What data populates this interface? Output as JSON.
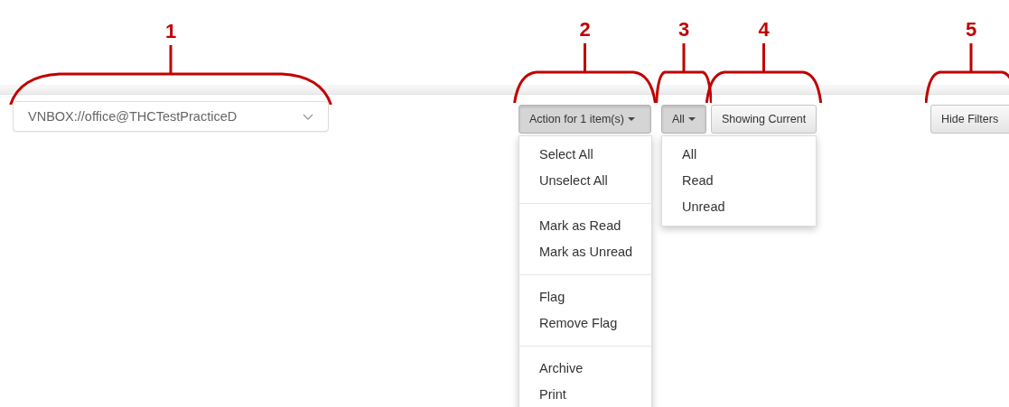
{
  "account_select": {
    "value": "VNBOX://office@THCTestPracticeD",
    "callout": "1"
  },
  "toolbar": [
    {
      "kind": "dropdown",
      "label": "Action for 1 item(s)",
      "callout": "2",
      "expanded": true,
      "menu": [
        [
          "Select All",
          "Unselect All"
        ],
        [
          "Mark as Read",
          "Mark as Unread"
        ],
        [
          "Flag",
          "Remove Flag"
        ],
        [
          "Archive",
          "Print"
        ]
      ]
    },
    {
      "kind": "dropdown",
      "label": "All",
      "callout": "3",
      "expanded": true,
      "menu": [
        [
          "All",
          "Read",
          "Unread"
        ]
      ]
    },
    {
      "kind": "button",
      "label": "Showing Current",
      "callout": "4"
    },
    {
      "kind": "button",
      "label": "Hide Filters",
      "callout": "5"
    }
  ]
}
